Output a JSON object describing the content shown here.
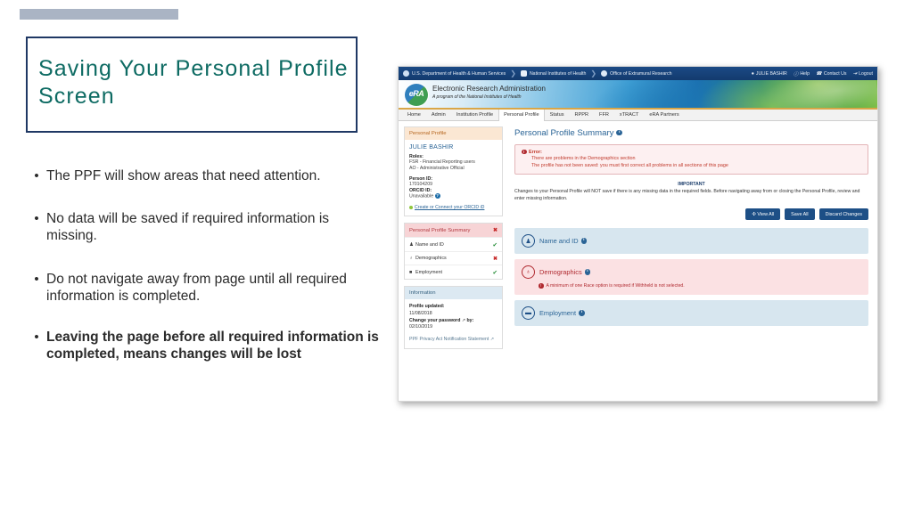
{
  "slide": {
    "title": "Saving Your Personal Profile Screen",
    "bullets": [
      {
        "text": "The PPF will show areas that need attention.",
        "bold": false
      },
      {
        "text": "No data will be saved if required information is missing.",
        "bold": false
      },
      {
        "text": "Do not navigate away from page until all required information is completed.",
        "bold": false
      },
      {
        "text": "Leaving the page before all required information is completed, means changes will be lost",
        "bold": true
      }
    ],
    "bullet_marker": "•"
  },
  "screenshot": {
    "hhs_bar": {
      "segments": [
        {
          "icon": "hhs-seal-icon",
          "label": "U.S. Department of Health & Human Services"
        },
        {
          "icon": "nih-logo-icon",
          "label": "National Institutes of Health"
        },
        {
          "icon": "oer-logo-icon",
          "label": "Office of Extramural Research"
        }
      ],
      "separator": "❯",
      "right_items": [
        {
          "icon": "user-icon",
          "glyph": "●",
          "label": "JULIE BASHIR"
        },
        {
          "icon": "help-icon",
          "glyph": "ⓘ",
          "label": "Help"
        },
        {
          "icon": "phone-icon",
          "glyph": "☎",
          "label": "Contact Us"
        },
        {
          "icon": "logout-icon",
          "glyph": "⇥",
          "label": "Logout"
        }
      ]
    },
    "banner": {
      "logo_text": "eRA",
      "title": "Electronic Research Administration",
      "subtitle": "A program of the National Institutes of Health"
    },
    "tabs": [
      {
        "label": "Home",
        "active": false
      },
      {
        "label": "Admin",
        "active": false
      },
      {
        "label": "Institution Profile",
        "active": false
      },
      {
        "label": "Personal Profile",
        "active": true
      },
      {
        "label": "Status",
        "active": false
      },
      {
        "label": "RPPR",
        "active": false
      },
      {
        "label": "FFR",
        "active": false
      },
      {
        "label": "xTRACT",
        "active": false
      },
      {
        "label": "eRA Partners",
        "active": false
      }
    ],
    "sidebar": {
      "profile_card": {
        "header": "Personal Profile",
        "user_name": "JULIE BASHIR",
        "roles_label": "Roles:",
        "roles": [
          "FSR - Financial Reporting users",
          "AO - Administrative Official"
        ],
        "person_id_label": "Person ID:",
        "person_id": "170104209",
        "orcid_label": "ORCID ID:",
        "orcid_value": "Unavailable",
        "orcid_link": "Create or Connect your ORCID iD"
      },
      "summary_card": {
        "header": "Personal Profile Summary",
        "header_status": "✖",
        "rows": [
          {
            "icon": "person-icon",
            "glyph": "♟",
            "label": "Name and ID",
            "status": "ok",
            "status_glyph": "✔"
          },
          {
            "icon": "globe-icon",
            "glyph": "♁",
            "label": "Demographics",
            "status": "bad",
            "status_glyph": "✖"
          },
          {
            "icon": "briefcase-icon",
            "glyph": "■",
            "label": "Employment",
            "status": "ok",
            "status_glyph": "✔"
          }
        ]
      },
      "information_card": {
        "header": "Information",
        "profile_updated_label": "Profile updated:",
        "profile_updated_value": "11/08/2018",
        "change_password_link": "Change your password",
        "change_password_by": "by:",
        "change_password_date": "02/10/2019",
        "privacy_link": "PPF Privacy Act Notification Statement"
      }
    },
    "main": {
      "page_title": "Personal Profile Summary",
      "error_panel": {
        "title": "Error:",
        "lines": [
          "There are problems in the Demographics section",
          "The profile has not been saved: you must first correct all problems in all sections of this page"
        ]
      },
      "important": {
        "title": "IMPORTANT",
        "body": "Changes to your Personal Profile will NOT save if there is any missing data in the required fields. Before navigating away from or closing the Personal Profile, review and enter missing information."
      },
      "buttons": [
        {
          "label": "✣ View All",
          "name": "view-all-button"
        },
        {
          "label": "Save All",
          "name": "save-all-button"
        },
        {
          "label": "Discard Changes",
          "name": "discard-changes-button"
        }
      ],
      "sections": [
        {
          "label": "Name and ID",
          "state": "ok",
          "icon": "person-circle-icon",
          "glyph": "♟",
          "message": ""
        },
        {
          "label": "Demographics",
          "state": "error",
          "icon": "globe-circle-icon",
          "glyph": "♁",
          "message": "A minimum of one Race option is required if Withheld is not selected."
        },
        {
          "label": "Employment",
          "state": "ok",
          "icon": "briefcase-circle-icon",
          "glyph": "▬",
          "message": ""
        }
      ]
    }
  },
  "colors": {
    "title_teal": "#0e6b63",
    "border_navy": "#1f3864",
    "era_blue": "#1d4f86",
    "error_red": "#b02a30",
    "ok_green": "#1f8a32"
  }
}
